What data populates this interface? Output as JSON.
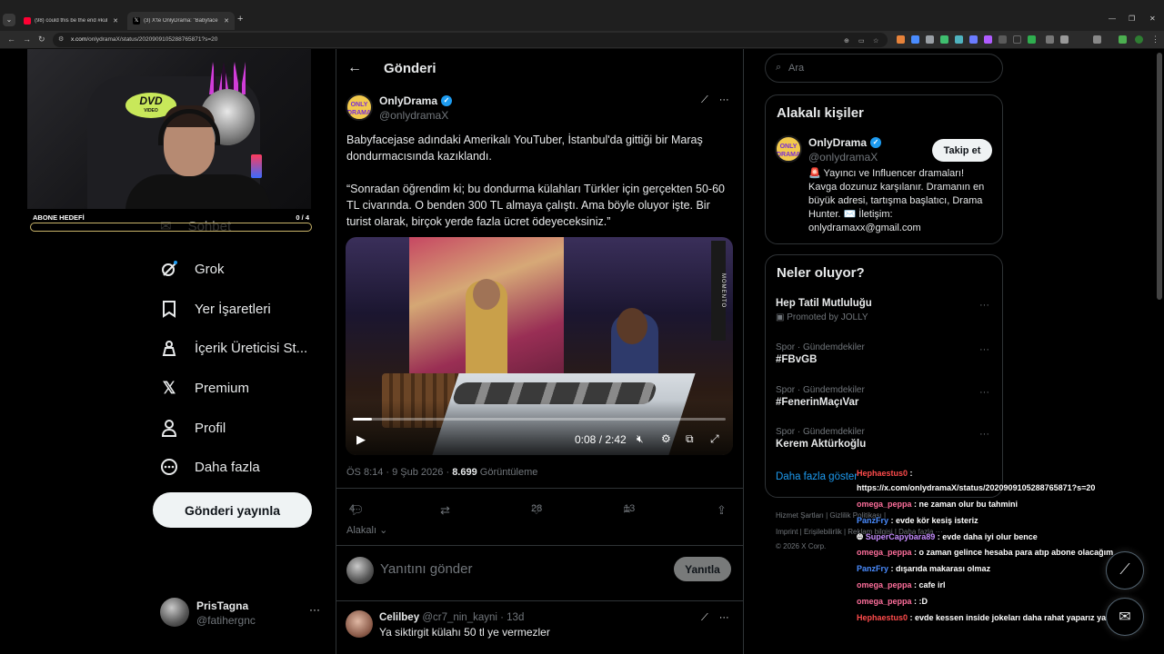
{
  "browser": {
    "tabs": [
      {
        "title": "(98) could this be the end #kul",
        "icon": "youtube-icon"
      },
      {
        "title": "(3) X'te OnlyDrama: \"Babyface",
        "icon": "x-logo-icon"
      }
    ],
    "url_host": "x.com",
    "url_path": "/onlydramaX/status/2020909105288765871?s=20"
  },
  "stream": {
    "goal_label": "ABONE HEDEFİ",
    "goal_count": "0 / 4",
    "goal_progress": 0,
    "dvd_text": "DVD",
    "dvd_sub": "VIDEO"
  },
  "nav": {
    "items": [
      {
        "label": "Sohbet",
        "icon": "mail-icon"
      },
      {
        "label": "Grok",
        "icon": "grok-icon"
      },
      {
        "label": "Yer İşaretleri",
        "icon": "bookmark-icon"
      },
      {
        "label": "İçerik Üreticisi St...",
        "icon": "creator-studio-icon"
      },
      {
        "label": "Premium",
        "icon": "x-logo-icon"
      },
      {
        "label": "Profil",
        "icon": "person-icon"
      },
      {
        "label": "Daha fazla",
        "icon": "more-circle-icon"
      }
    ],
    "post_button": "Gönderi yayınla",
    "profile": {
      "name": "PrisTagna",
      "handle": "@fatihergnc"
    }
  },
  "post": {
    "header_title": "Gönderi",
    "author": {
      "name": "OnlyDrama",
      "handle": "@onlydramaX",
      "avatar_text": "ONLY DRAMA"
    },
    "text1": "Babyfacejase adındaki Amerikalı YouTuber, İstanbul'da gittiği bir Maraş dondurmacısında kazıklandı.",
    "text2": "“Sonradan öğrendim ki; bu dondurma külahları Türkler için gerçekten 50-60 TL civarında. O benden 300 TL almaya çalıştı. Ama böyle oluyor işte. Bir turist olarak, birçok yerde fazla ücret ödeyeceksiniz.”",
    "video": {
      "time": "0:08 / 2:42",
      "progress": 0.05,
      "sign_text": "MOMENTO"
    },
    "timestamp": "ÖS 8:14 · 9 Şub 2026 · ",
    "views": "8.699",
    "views_label": " Görüntüleme",
    "stats": {
      "replies": "4",
      "reposts": "",
      "likes": "28",
      "bookmarks": "13"
    },
    "sort_label": "Alakalı",
    "reply_placeholder": "Yanıtını gönder",
    "reply_button": "Yanıtla"
  },
  "reply": {
    "name": "Celilbey",
    "handle": "@cr7_nin_kayni · 13d",
    "text": "Ya siktirgit külahı 50 tl ye vermezler"
  },
  "sidebar": {
    "search_placeholder": "Ara",
    "related_title": "Alakalı kişiler",
    "related": {
      "name": "OnlyDrama",
      "handle": "@onlydramaX",
      "follow": "Takip et",
      "bio": "🚨 Yayıncı ve Influencer dramaları! Kavga dozunuz karşılanır. Dramanın en büyük adresi, tartışma başlatıcı, Drama Hunter. ✉️ İletişim: onlydramaxx@gmail.com"
    },
    "trends_title": "Neler oluyor?",
    "trends": [
      {
        "name": "Hep Tatil Mutluluğu",
        "context": "Promoted by JOLLY"
      },
      {
        "context": "Spor · Gündemdekiler",
        "name": "#FBvGB"
      },
      {
        "context": "Spor · Gündemdekiler",
        "name": "#FenerinMaçıVar"
      },
      {
        "context": "Spor · Gündemdekiler",
        "name": "Kerem Aktürkoğlu"
      }
    ],
    "show_more": "Daha fazla göster",
    "footer1": "Hizmet Şartları  |  Gizlilik Politikası  |",
    "footer2": "Imprint  |  Erişilebilirlik  |  Reklam bilgisi  |  Daha fazla ···",
    "footer3": "© 2026 X Corp."
  },
  "chat": [
    {
      "user": "Hephaestus0",
      "msg": " :"
    },
    {
      "user": "",
      "msg": "https://x.com/onlydramaX/status/2020909105288765871?s=20"
    },
    {
      "user": "omega_peppa",
      "msg": " : ne zaman olur bu tahmini"
    },
    {
      "user": "PanzFry",
      "msg": " : evde kör kesiş isteriz"
    },
    {
      "user": "SuperCapybara89",
      "msg": " : evde daha iyi olur bence"
    },
    {
      "user": "omega_peppa",
      "msg": " : o zaman gelince hesaba para atıp abone olacağım"
    },
    {
      "user": "PanzFry",
      "msg": " : dışarıda makarası olmaz"
    },
    {
      "user": "omega_peppa",
      "msg": " : cafe irl"
    },
    {
      "user": "omega_peppa",
      "msg": " : :D"
    },
    {
      "user": "Hephaestus0",
      "msg": " : evde kessen inside jokeları daha rahat yaparız ya"
    }
  ]
}
